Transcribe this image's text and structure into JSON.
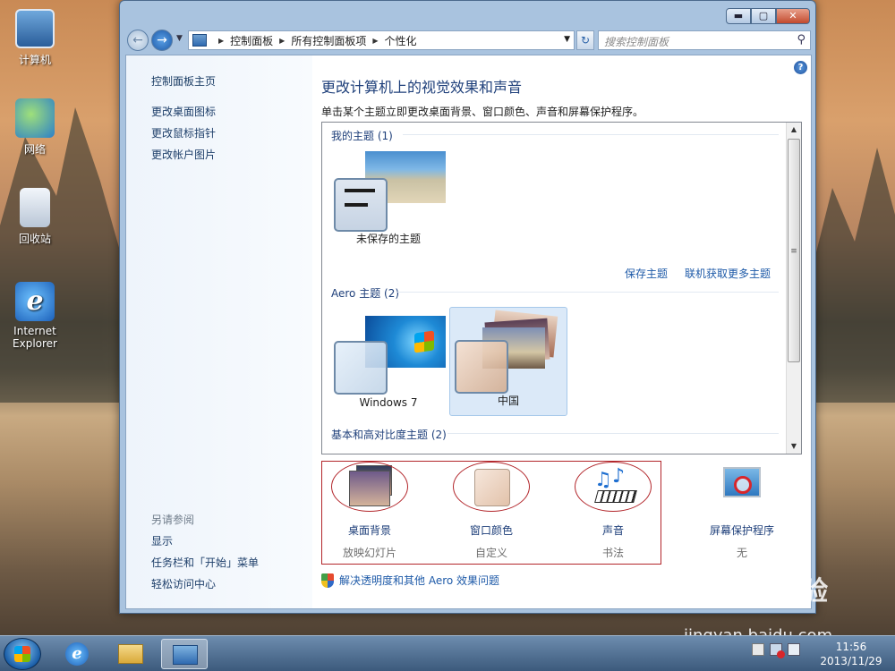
{
  "desktop": {
    "icons": [
      {
        "label": "计算机"
      },
      {
        "label": "网络"
      },
      {
        "label": "回收站"
      },
      {
        "label": "Internet Explorer"
      }
    ]
  },
  "window": {
    "buttons": {
      "minimize": "▬",
      "maximize": "▢",
      "close": "✕"
    },
    "address": {
      "crumbs": [
        "控制面板",
        "所有控制面板项",
        "个性化"
      ]
    },
    "search": {
      "placeholder": "搜索控制面板"
    }
  },
  "leftpane": {
    "home": "控制面板主页",
    "links": [
      "更改桌面图标",
      "更改鼠标指针",
      "更改帐户图片"
    ],
    "see_also_title": "另请参阅",
    "see_also": [
      "显示",
      "任务栏和「开始」菜单",
      "轻松访问中心"
    ]
  },
  "main": {
    "title": "更改计算机上的视觉效果和声音",
    "subtitle": "单击某个主题立即更改桌面背景、窗口颜色、声音和屏幕保护程序。",
    "sections": {
      "my_themes": "我的主题 (1)",
      "aero_themes": "Aero 主题 (2)",
      "basic_themes": "基本和高对比度主题 (2)"
    },
    "themes": {
      "unsaved": "未保存的主题",
      "windows7": "Windows 7",
      "china": "中国"
    },
    "links": {
      "save_theme": "保存主题",
      "get_more": "联机获取更多主题"
    },
    "settings": [
      {
        "name": "桌面背景",
        "value": "放映幻灯片"
      },
      {
        "name": "窗口颜色",
        "value": "自定义"
      },
      {
        "name": "声音",
        "value": "书法"
      },
      {
        "name": "屏幕保护程序",
        "value": "无"
      }
    ],
    "aero_troubleshoot": "解决透明度和其他 Aero 效果问题"
  },
  "taskbar": {
    "clock_time": "11:56",
    "clock_date": "2013/11/29"
  },
  "watermark": {
    "brand": "Bai du 经验",
    "url": "jingyan.baidu.com"
  }
}
